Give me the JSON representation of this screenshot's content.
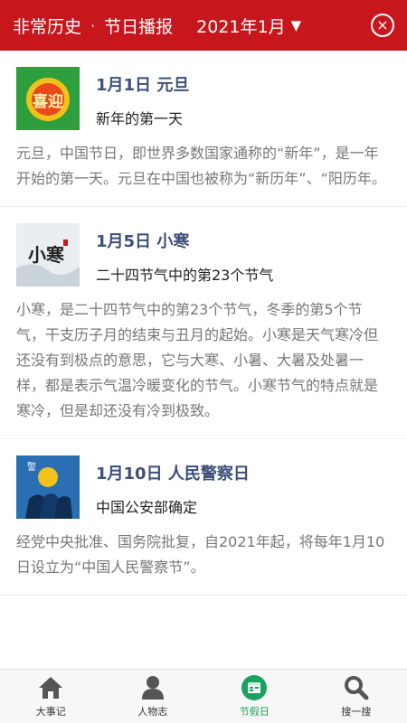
{
  "header": {
    "app_title": "非常历史",
    "separator": "·",
    "section_title": "节日播报",
    "month": "2021年1月",
    "dropdown_glyph": "▼",
    "close_glyph": "×"
  },
  "entries": [
    {
      "title": "1月1日 元旦",
      "subtitle": "新年的第一天",
      "description": "元旦，中国节日，即世界多数国家通称的“新年”，是一年开始的第一天。元旦在中国也被称为“新历年”、“阳历年。",
      "thumb_text": "喜迎",
      "thumb_icon": "new-year-image"
    },
    {
      "title": "1月5日 小寒",
      "subtitle": "二十四节气中的第23个节气",
      "description": "小寒，是二十四节气中的第23个节气，冬季的第5个节气，干支历子月的结束与丑月的起始。小寒是天气寒冷但还没有到极点的意思，它与大寒、小暑、大暑及处暑一样，都是表示气温冷暖变化的节气。小寒节气的特点就是寒冷，但是却还没有冷到极致。",
      "thumb_text": "小寒",
      "thumb_icon": "calligraphy-image"
    },
    {
      "title": "1月10日 人民警察日",
      "subtitle": "中国公安部确定",
      "description": "经党中央批准、国务院批复，自2021年起，将每年1月10日设立为“中国人民警察节”。",
      "thumb_text": "警",
      "thumb_icon": "police-image"
    }
  ],
  "tabs": [
    {
      "label": "大事记",
      "icon": "home-icon",
      "active": false
    },
    {
      "label": "人物志",
      "icon": "person-icon",
      "active": false
    },
    {
      "label": "节假日",
      "icon": "calendar-icon",
      "active": true
    },
    {
      "label": "搜一搜",
      "icon": "search-icon",
      "active": false
    }
  ],
  "colors": {
    "header_bg": "#c8161d",
    "title": "#3d4f7a",
    "active_tab": "#1aa260"
  }
}
